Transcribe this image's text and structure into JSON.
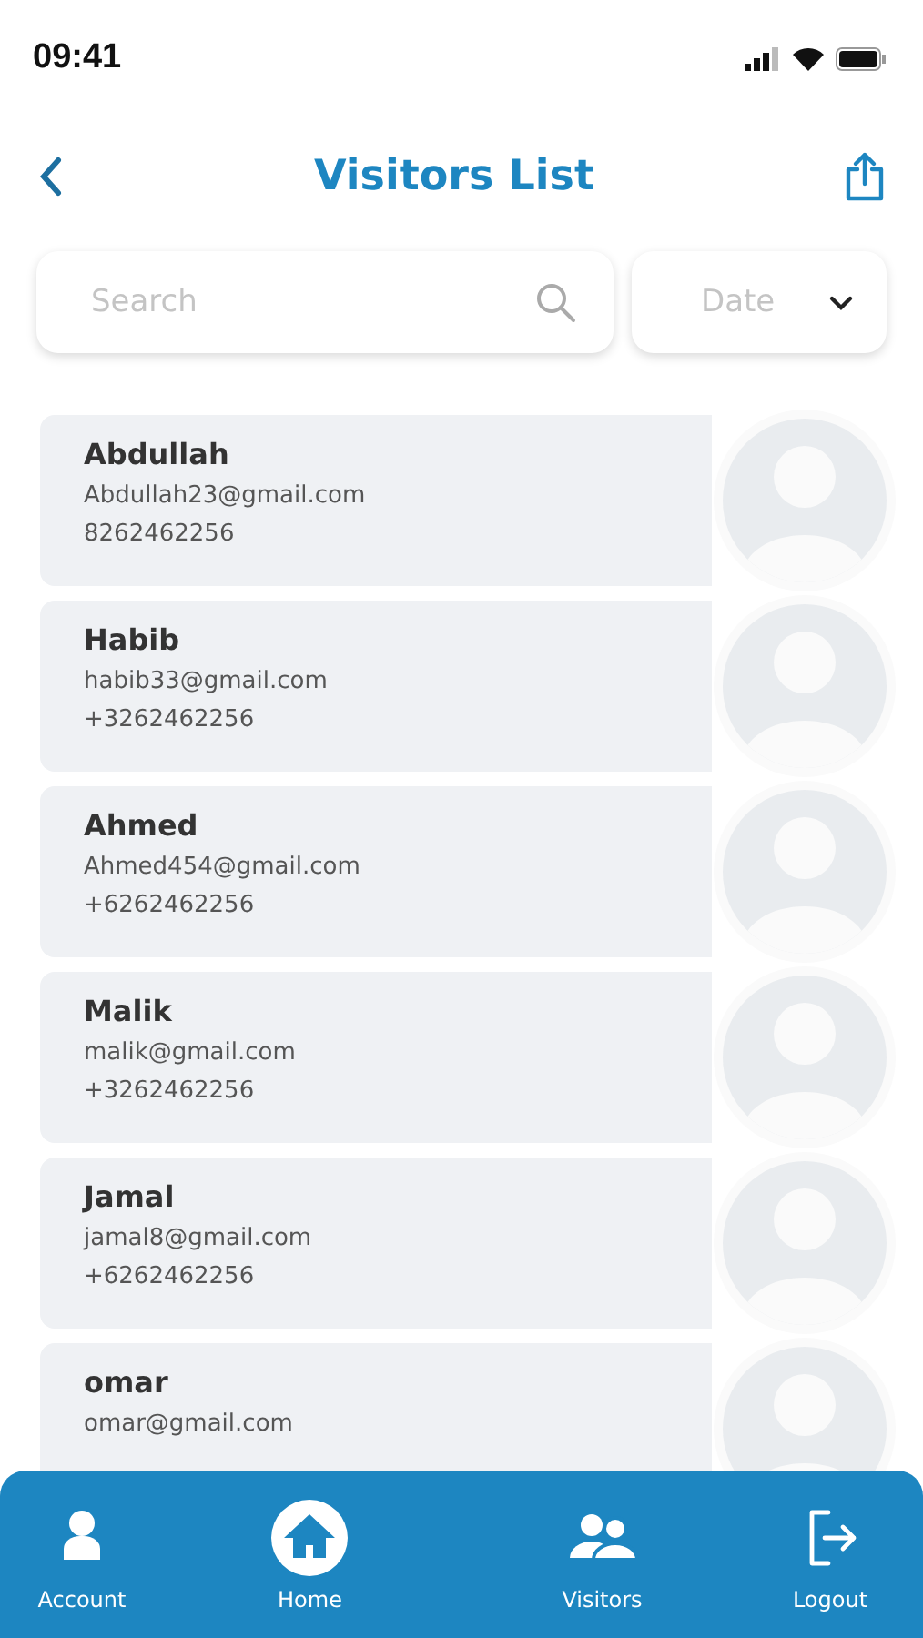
{
  "status_bar": {
    "time": "09:41"
  },
  "header": {
    "title": "Visitors List"
  },
  "search": {
    "placeholder": "Search"
  },
  "date_filter": {
    "placeholder": "Date"
  },
  "visitors": [
    {
      "name": "Abdullah",
      "email": "Abdullah23@gmail.com",
      "phone": "8262462256"
    },
    {
      "name": "Habib",
      "email": "habib33@gmail.com",
      "phone": "+3262462256"
    },
    {
      "name": "Ahmed",
      "email": "Ahmed454@gmail.com",
      "phone": "+6262462256"
    },
    {
      "name": "Malik",
      "email": "malik@gmail.com",
      "phone": "+3262462256"
    },
    {
      "name": "Jamal",
      "email": "jamal8@gmail.com",
      "phone": "+6262462256"
    },
    {
      "name": "omar",
      "email": "omar@gmail.com"
    }
  ],
  "bottom_nav": [
    {
      "kind": "account",
      "label": "Account",
      "selected": false
    },
    {
      "kind": "home",
      "label": "Home",
      "selected": true
    },
    {
      "kind": "visitors",
      "label": "Visitors",
      "selected": false
    },
    {
      "kind": "logout",
      "label": "Logout",
      "selected": false
    }
  ]
}
